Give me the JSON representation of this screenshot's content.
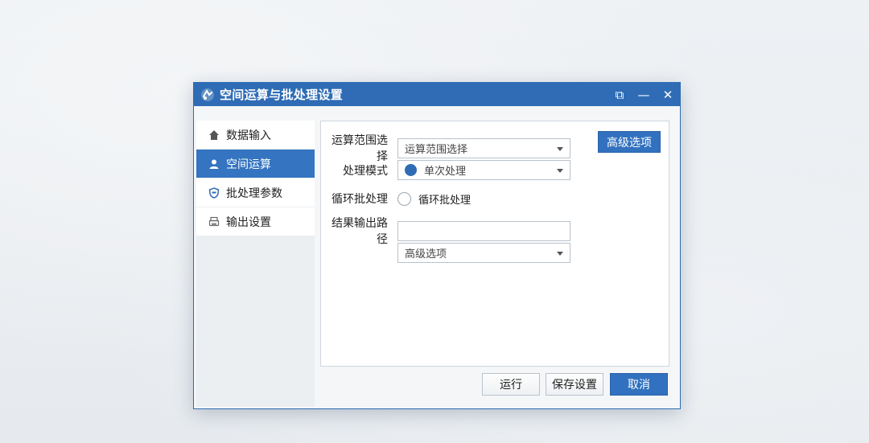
{
  "window": {
    "title": "空间运算与批处理设置",
    "controls": {
      "restore": "⧉",
      "minimize": "—",
      "close": "✕"
    }
  },
  "sidebar": {
    "items": [
      {
        "label": "数据输入",
        "icon": "home-icon",
        "active": false
      },
      {
        "label": "空间运算",
        "icon": "user-icon",
        "active": true
      },
      {
        "label": "批处理参数",
        "icon": "shield-icon",
        "active": false
      },
      {
        "label": "输出设置",
        "icon": "printer-icon",
        "active": false
      }
    ]
  },
  "form": {
    "scope_label": "运算范围选择",
    "scope_value": "运算范围选择",
    "advanced_button": "高级选项",
    "mode_label": "处理模式",
    "mode_value": "单次处理",
    "loop_label": "循环批处理",
    "loop_option": "循环批处理",
    "output_label": "结果输出路径",
    "output_value": "",
    "advanced_combo_value": "高级选项"
  },
  "footer": {
    "run": "运行",
    "save": "保存设置",
    "cancel": "取消"
  },
  "colors": {
    "accent": "#2f6cb5",
    "active_nav": "#3474c0",
    "background": "#e9edf1"
  }
}
